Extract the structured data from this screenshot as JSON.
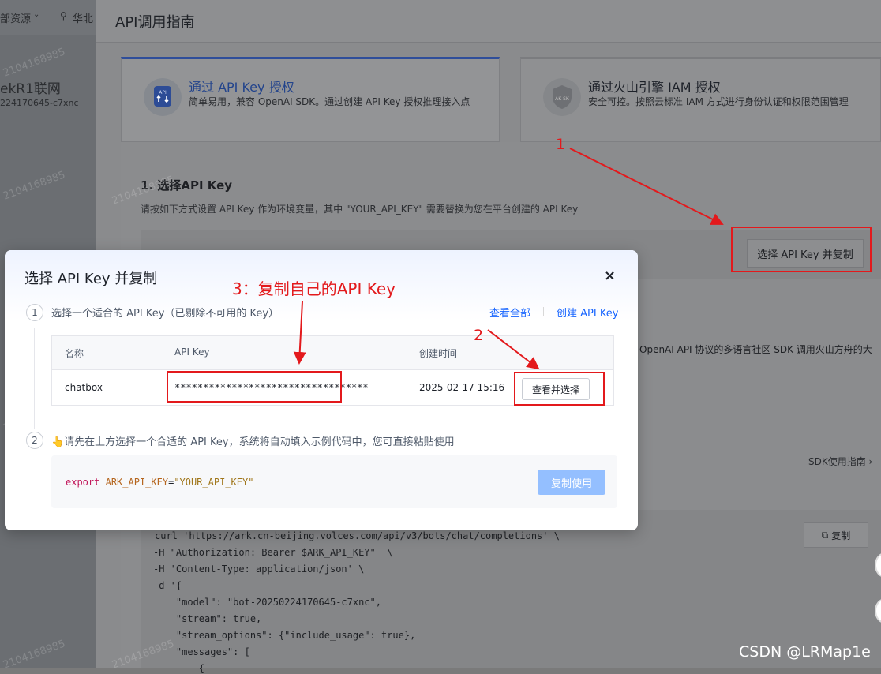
{
  "left_panel": {
    "resource_dropdown": "部资源",
    "region": "华北",
    "app_name": "ekR1联网",
    "app_id": "224170645-c7xnc"
  },
  "page": {
    "title": "API调用指南"
  },
  "auth_cards": [
    {
      "title": "通过 API Key 授权",
      "desc": "简单易用，兼容 OpenAI SDK。通过创建 API Key 授权推理接入点"
    },
    {
      "title": "通过火山引擎 IAM 授权",
      "desc": "安全可控。按照云标准 IAM 方式进行身份认证和权限范围管理"
    }
  ],
  "step1": {
    "title": "1. 选择API Key",
    "desc": "请按如下方式设置 API Key 作为环境变量，其中 \"YOUR_API_KEY\" 需要替换为您在平台创建的 API Key",
    "select_copy_button": "选择 API Key 并复制"
  },
  "background_text": {
    "openai_desc": "OpenAI API 协议的多语言社区 SDK 调用火山方舟的大",
    "sdk_guide": "SDK使用指南 ›",
    "copy_button": "复制"
  },
  "background_code": [
    "curl 'https://ark.cn-beijing.volces.com/api/v3/bots/chat/completions' \\",
    "-H \"Authorization: Bearer $ARK_API_KEY\"  \\",
    "-H 'Content-Type: application/json' \\",
    "-d '{",
    "    \"model\": \"bot-20250224170645-c7xnc\",",
    "    \"stream\": true,",
    "    \"stream_options\": {\"include_usage\": true},",
    "    \"messages\": [",
    "        {"
  ],
  "modal": {
    "title": "选择 API Key 并复制",
    "close": "×",
    "step1_num": "1",
    "step1_text": "选择一个适合的 API Key（已剔除不可用的 Key）",
    "view_all": "查看全部",
    "create_key": "创建 API Key",
    "table": {
      "headers": [
        "名称",
        "API Key",
        "创建时间"
      ],
      "rows": [
        {
          "name": "chatbox",
          "key": "**********************************",
          "created": "2025-02-17 15:16",
          "action": "查看并选择"
        }
      ]
    },
    "step2_num": "2",
    "step2_text": "👆请先在上方选择一个合适的 API Key，系统将自动填入示例代码中，您可直接粘贴使用",
    "code": {
      "keyword": "export",
      "var": "ARK_API_KEY",
      "eq": "=",
      "value": "\"YOUR_API_KEY\""
    },
    "copy_use_button": "复制使用"
  },
  "annotations": {
    "label1": "1",
    "label2": "2",
    "label3": "3：复制自己的API Key",
    "color": "#e3191c"
  },
  "watermark": "2104168985",
  "csdn": "CSDN @LRMap1e"
}
